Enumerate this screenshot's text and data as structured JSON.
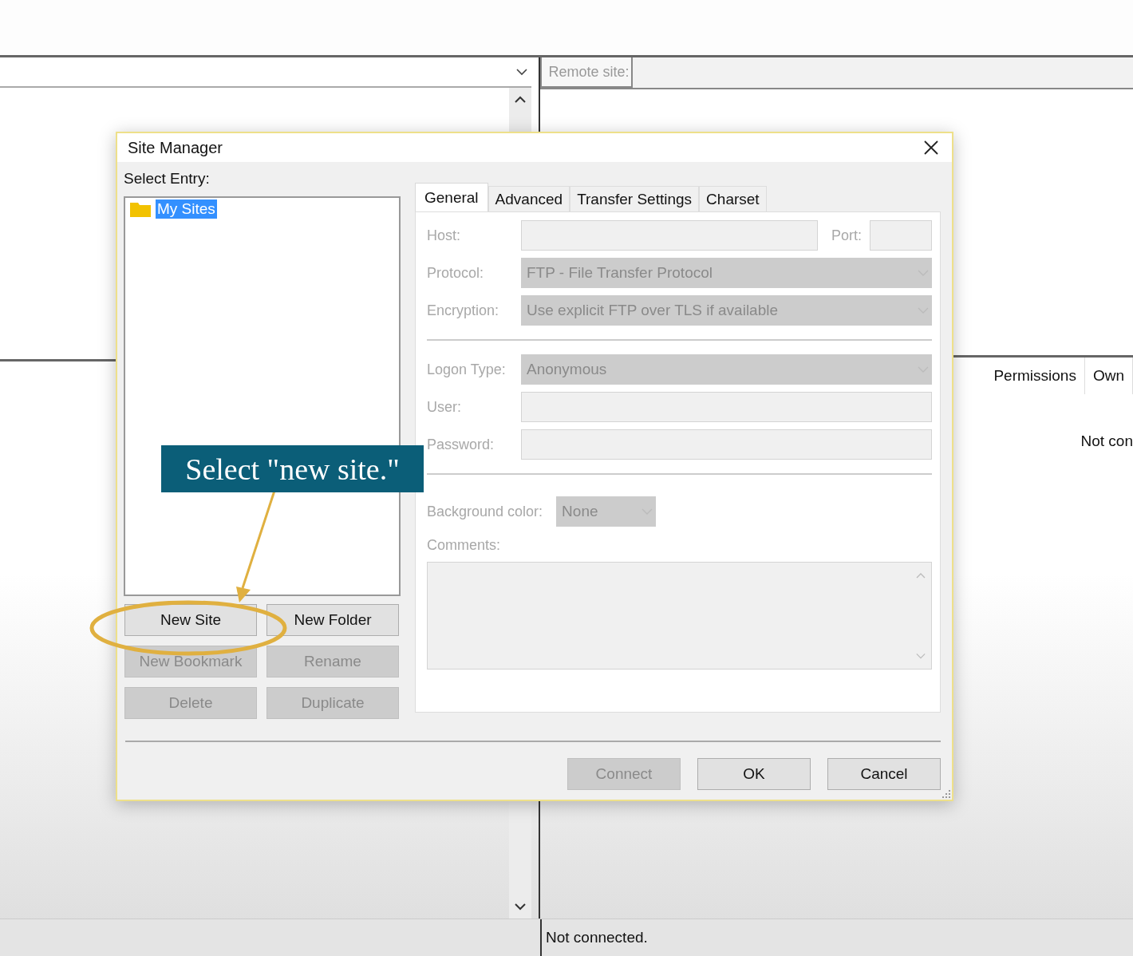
{
  "remote_panel": {
    "label": "Remote site:",
    "columns": [
      {
        "label": "Permissions"
      },
      {
        "label": "Own"
      }
    ],
    "message": "Not con"
  },
  "status_bar": {
    "text": "Not connected."
  },
  "dialog": {
    "title": "Site Manager",
    "entry_label": "Select Entry:",
    "tree": [
      {
        "label": "My Sites",
        "selected": true
      }
    ],
    "entry_buttons": [
      {
        "label": "New Site",
        "disabled": false
      },
      {
        "label": "New Folder",
        "disabled": false
      },
      {
        "label": "New Bookmark",
        "disabled": true
      },
      {
        "label": "Rename",
        "disabled": true
      },
      {
        "label": "Delete",
        "disabled": true
      },
      {
        "label": "Duplicate",
        "disabled": true
      }
    ],
    "tabs": [
      {
        "label": "General",
        "selected": true
      },
      {
        "label": "Advanced",
        "selected": false
      },
      {
        "label": "Transfer Settings",
        "selected": false
      },
      {
        "label": "Charset",
        "selected": false
      }
    ],
    "form_disabled": true,
    "form": [
      {
        "kind": "host",
        "label": "Host:",
        "port_label": "Port:"
      },
      {
        "kind": "select",
        "label": "Protocol:",
        "value": "FTP - File Transfer Protocol"
      },
      {
        "kind": "select",
        "label": "Encryption:",
        "value": "Use explicit FTP over TLS if available"
      },
      {
        "kind": "separator"
      },
      {
        "kind": "select",
        "label": "Logon Type:",
        "value": "Anonymous"
      },
      {
        "kind": "text",
        "label": "User:"
      },
      {
        "kind": "text",
        "label": "Password:"
      },
      {
        "kind": "separator"
      },
      {
        "kind": "small_select",
        "label": "Background color:",
        "value": "None"
      },
      {
        "kind": "textarea",
        "label": "Comments:"
      }
    ],
    "footer_buttons": [
      {
        "label": "Connect",
        "disabled": true
      },
      {
        "label": "OK",
        "disabled": false
      },
      {
        "label": "Cancel",
        "disabled": false
      }
    ]
  },
  "annotation": {
    "callout": "Select \"new site.\""
  }
}
